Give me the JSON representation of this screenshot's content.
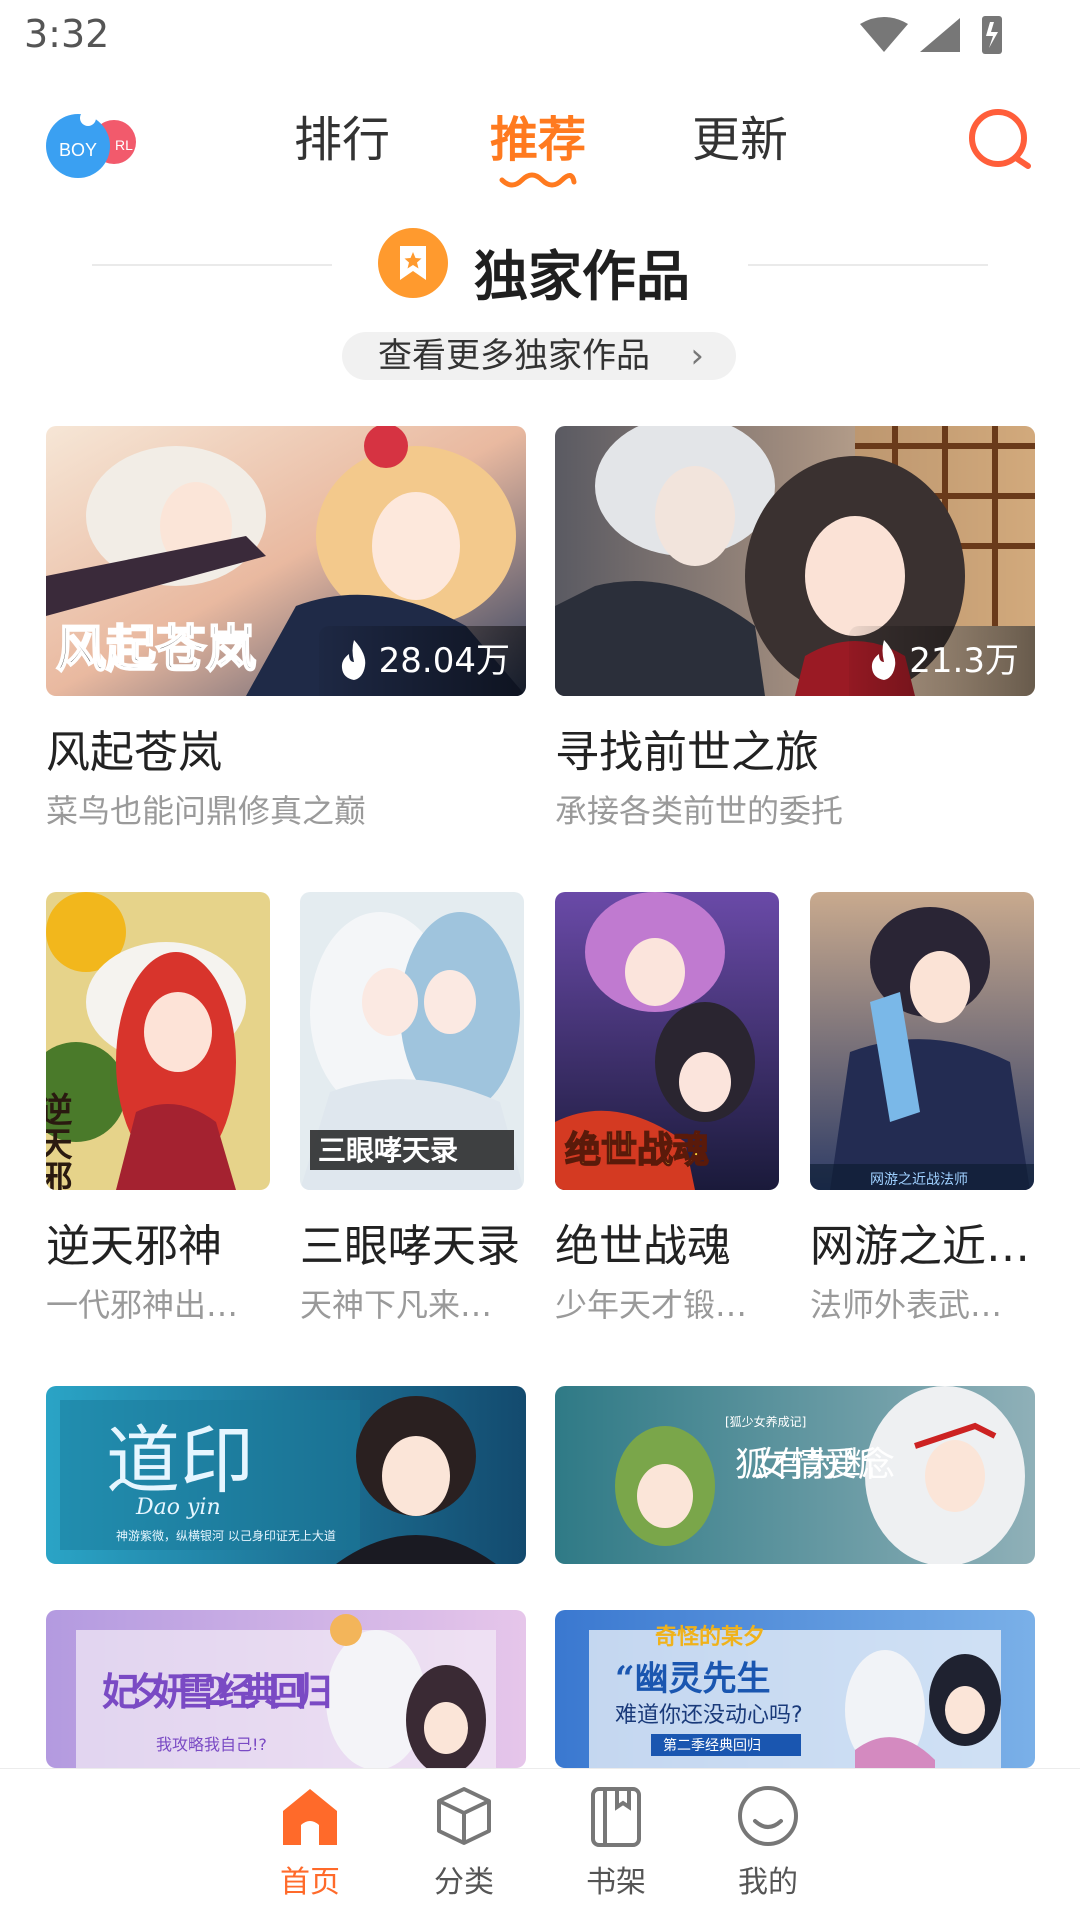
{
  "status_bar": {
    "time": "3:32"
  },
  "top_nav": {
    "toggle": {
      "boy": "BOY",
      "girl": "RL"
    },
    "tabs": [
      {
        "label": "排行"
      },
      {
        "label": "推荐"
      },
      {
        "label": "更新"
      }
    ],
    "active_tab": "推荐"
  },
  "section": {
    "title": "独家作品",
    "more_label": "查看更多独家作品",
    "featured": [
      {
        "cover_text": "风起苍岚",
        "title": "风起苍岚",
        "desc": "菜鸟也能问鼎修真之巅",
        "hot": "28.04万"
      },
      {
        "title": "寻找前世之旅",
        "desc": "承接各类前世的委托",
        "hot": "21.3万"
      }
    ],
    "grid": [
      {
        "cover_text": "逆天邪神",
        "title": "逆天邪神",
        "desc": "一代邪神出…"
      },
      {
        "cover_text": "三眼哮天录",
        "title": "三眼哮天录",
        "desc": "天神下凡来…"
      },
      {
        "cover_text": "绝世战魂",
        "title": "绝世战魂",
        "desc": "少年天才锻…"
      },
      {
        "cover_text": "网游之近战法师",
        "title": "网游之近…",
        "desc": "法师外表武…"
      }
    ],
    "banners": [
      {
        "cover_text": "道印",
        "sub": "Dao yin",
        "tagline": "神游紫微，纵横银河 以己身印证无上大道"
      },
      {
        "cover_text": "狐女有情 为爱断念",
        "tag": "[狐少女养成记]"
      },
      {
        "cover_text": "妃夕妍雪2 经典回归",
        "sub": "我攻略我自己!?"
      },
      {
        "cover_text": "奇怪的某夕",
        "line1": "“幽灵先生",
        "line2": "难道你还没动心吗?",
        "tag": "第二季经典回归"
      }
    ]
  },
  "bottom_nav": {
    "items": [
      {
        "label": "首页",
        "icon": "home-icon"
      },
      {
        "label": "分类",
        "icon": "cube-icon"
      },
      {
        "label": "书架",
        "icon": "bookshelf-icon"
      },
      {
        "label": "我的",
        "icon": "profile-icon"
      }
    ],
    "active": "首页"
  },
  "colors": {
    "accent": "#ff7a1f",
    "bottom_active": "#ff6a2a"
  }
}
